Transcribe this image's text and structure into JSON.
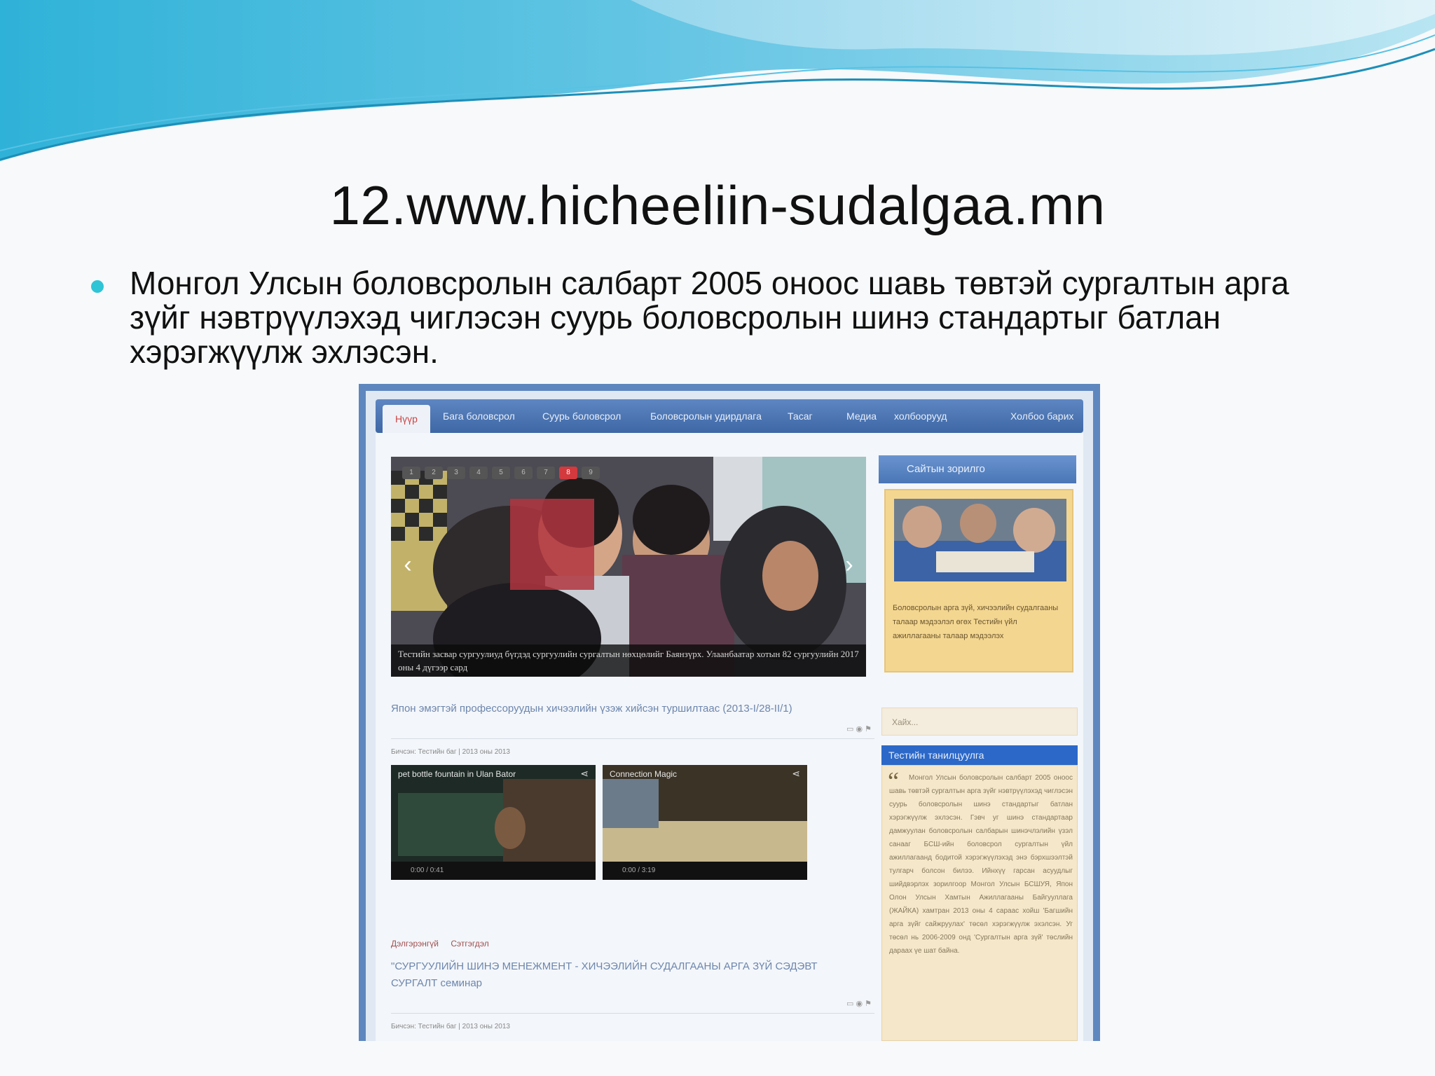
{
  "slide": {
    "title": "12.www.hicheeliin-sudalgaa.mn",
    "bullet": "Монгол Улсын боловсролын салбарт 2005 оноос шавь төвтэй сургалтын арга зүйг нэвтрүүлэхэд чиглэсэн суурь боловсролын шинэ стандартыг батлан хэрэгжүүлж эхлэсэн.",
    "colors": {
      "accent": "#2fc4d6",
      "wave": "#4fb4da"
    }
  },
  "website": {
    "nav": [
      "Нүүр",
      "Бага боловсрол",
      "Суурь боловсрол",
      "Боловсролын удирдлага",
      "Тасаг",
      "Медиа",
      "Холбоо барих"
    ],
    "slider": {
      "pager": [
        "1",
        "2",
        "3",
        "4",
        "5",
        "6",
        "7",
        "8",
        "9"
      ],
      "active_page": "8",
      "caption": "Тестийн засвар сургуулиуд бүгдэд сургуулийн сургалтын нөхцөлийг Баянзүрх. Улаанбаатар хотын 82 сургуулийн 2017 оны 4 дүгээр сард"
    },
    "sidebar": {
      "title": "Сайтын зорилго",
      "text": "Боловсролын арга зүй, хичээлийн судалгааны талаар мэдээлэл өгөх Тестийн үйл ажиллагааны талаар мэдээлэх"
    },
    "news": {
      "title": "Япон эмэгтэй профессоруудын хичээлийн үзэж хийсэн туршилтаас (2013-I/28-II/1)",
      "meta": "Бичсэн: Тестийн баг | 2013 оны 2013",
      "videos": [
        {
          "title": "pet bottle fountain in Ulan Bator",
          "time": "0:00 / 0:41"
        },
        {
          "title": "Connection Magic",
          "time": "0:00 / 3:19"
        }
      ]
    },
    "post": {
      "tags": [
        "Дэлгэрэнгүй",
        "Сэтгэгдэл"
      ],
      "title": "\"СУРГУУЛИЙН ШИНЭ МЕНЕЖМЕНТ - ХИЧЭЭЛИЙН СУДАЛГААНЫ АРГА ЗҮЙ СЭДЭВТ СУРГАЛТ семинар",
      "meta": "Бичсэн: Тестийн баг | 2013 оны 2013"
    },
    "search_placeholder": "Хайх...",
    "about": {
      "title": "Тестийн танилцуулга",
      "text": "Монгол Улсын боловсролын салбарт 2005 оноос шавь төвтэй сургалтын арга зүйг нэвтрүүлэхэд чиглэсэн суурь боловсролын шинэ стандартыг батлан хэрэгжүүлж эхлэсэн. Гэвч уг шинэ стандартаар дамжуулан боловсролын салбарын шинэчлэлийн үзэл санааг БСШ-ийн боловсрол сургалтын үйл ажиллагаанд бодитой хэрэгжүүлэхэд энэ бэрхшээлтэй тулгарч болсон билээ. Ийнхүү гарсан асуудлыг шийдвэрлэх зорилгоор Монгол Улсын БСШУЯ, Япон Олон Улсын Хамтын Ажиллагааны Байгууллага (ЖАЙКА) хамтран 2013 оны 4 сараас хойш 'Багшийн арга зүйг сайжруулах' төсөл хэрэгжүүлж эхэлсэн. Уг төсөл нь 2006-2009 онд 'Сургалтын арга зүй' төслийн дараах үе шат байна."
    }
  }
}
